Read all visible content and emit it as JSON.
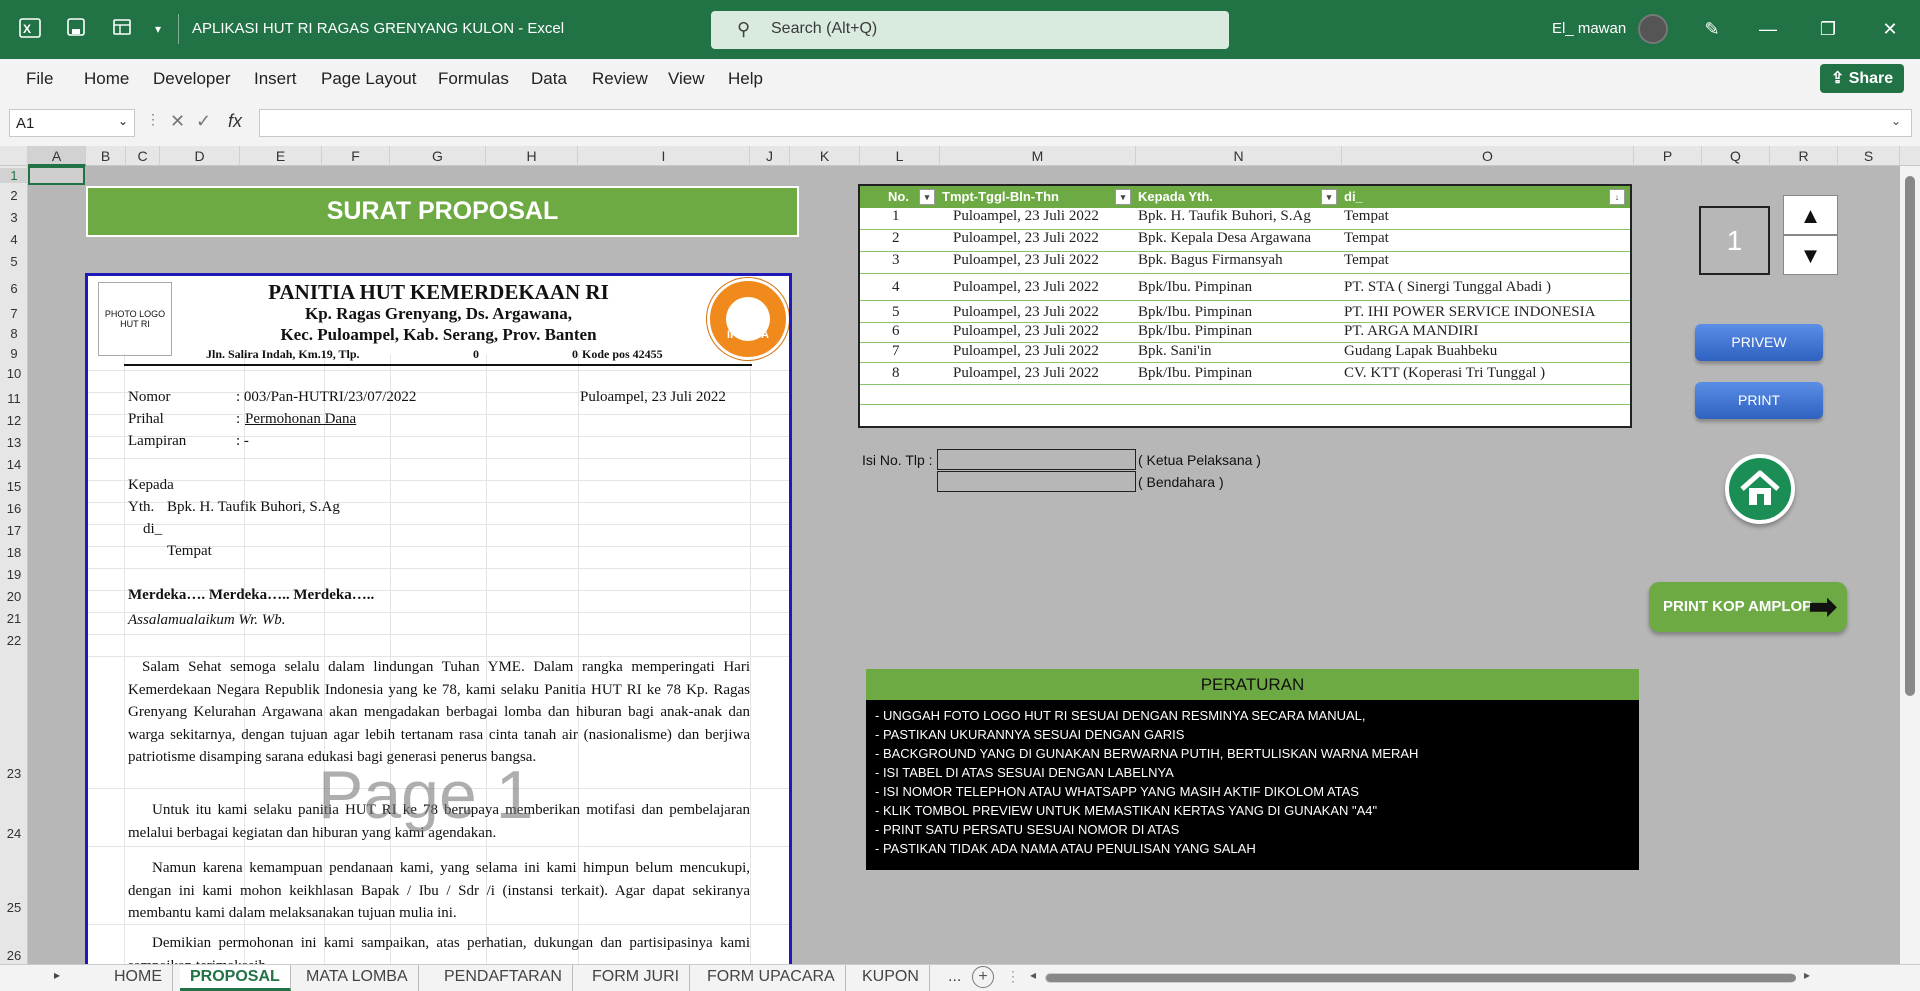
{
  "app": {
    "title": "APLIKASI HUT RI RAGAS GRENYANG KULON  -  Excel",
    "search_placeholder": "Search (Alt+Q)",
    "user": "El_ mawan",
    "share_label": "Share"
  },
  "ribbon": {
    "tabs": [
      "File",
      "Home",
      "Developer",
      "Insert",
      "Page Layout",
      "Formulas",
      "Data",
      "Review",
      "View",
      "Help"
    ]
  },
  "formula_bar": {
    "name_box": "A1",
    "formula": ""
  },
  "columns": [
    "A",
    "B",
    "C",
    "D",
    "E",
    "F",
    "G",
    "H",
    "I",
    "J",
    "K",
    "L",
    "M",
    "N",
    "O",
    "P",
    "Q",
    "R",
    "S"
  ],
  "rows": [
    "1",
    "2",
    "3",
    "4",
    "5",
    "6",
    "7",
    "8",
    "9",
    "10",
    "11",
    "12",
    "13",
    "14",
    "15",
    "16",
    "17",
    "18",
    "19",
    "20",
    "21",
    "22",
    "23",
    "24",
    "25",
    "26"
  ],
  "doc": {
    "banner": "SURAT PROPOSAL",
    "photo_label": "PHOTO LOGO HUT RI",
    "logo_text": "IPARGA",
    "kop1": "PANITIA HUT KEMERDEKAAN RI",
    "kop2": "Kp. Ragas Grenyang,  Ds. Argawana,",
    "kop3": "Kec. Puloampel, Kab. Serang, Prov. Banten",
    "kop4_addr": "Jln. Salira Indah, Km.19, Tlp.",
    "kop4_tlp1": "0",
    "kop4_tlp2": "0",
    "kop4_pos": "Kode pos 42455",
    "nomor_label": "Nomor",
    "nomor_value": ": 003/Pan-HUTRI/23/07/2022",
    "place_date": "Puloampel, 23 Juli 2022",
    "prihal_label": "Prihal",
    "prihal_value": "Permohonan Dana",
    "lampiran_label": "Lampiran",
    "lampiran_value": ": -",
    "kepada": "Kepada",
    "yth": "Yth.",
    "yth_name": "Bpk. H. Taufik Buhori, S.Ag",
    "di": "di_",
    "tempat": "Tempat",
    "merdeka": "Merdeka…. Merdeka….. Merdeka…..",
    "salam": "Assalamualaikum Wr. Wb.",
    "para1": "Salam Sehat semoga selalu dalam lindungan Tuhan YME. Dalam rangka memperingati Hari Kemerdekaan Negara Republik Indonesia yang ke 78, kami selaku Panitia HUT RI ke 78 Kp. Ragas Grenyang Kelurahan Argawana akan mengadakan berbagai lomba dan hiburan bagi anak-anak dan warga sekitarnya, dengan tujuan agar lebih tertanam rasa cinta tanah air (nasionalisme) dan berjiwa patriotisme disamping sarana edukasi bagi generasi penerus bangsa.",
    "para2": "Untuk itu kami selaku panitia HUT RI ke 78 berupaya memberikan motifasi dan pembelajaran melalui berbagai kegiatan dan hiburan yang kami agendakan.",
    "para3": "Namun karena kemampuan pendanaan kami, yang selama ini kami himpun belum mencukupi, dengan ini kami mohon keikhlasan Bapak / Ibu / Sdr /i (instansi terkait). Agar dapat sekiranya membantu kami dalam melaksanakan tujuan mulia ini.",
    "para4": "Demikian permohonan ini kami sampaikan, atas perhatian, dukungan dan partisipasinya kami sampaikan terimakasih.",
    "watermark": "Page 1"
  },
  "table": {
    "headers": [
      "No.",
      "Tmpt-Tggl-Bln-Thn",
      "Kepada Yth.",
      "di_"
    ],
    "rows": [
      [
        "1",
        "Puloampel, 23 Juli 2022",
        "Bpk. H. Taufik Buhori, S.Ag",
        "Tempat"
      ],
      [
        "2",
        "Puloampel, 23 Juli 2022",
        "Bpk. Kepala Desa Argawana",
        "Tempat"
      ],
      [
        "3",
        "Puloampel, 23 Juli 2022",
        "Bpk. Bagus Firmansyah",
        "Tempat"
      ],
      [
        "4",
        "Puloampel, 23 Juli 2022",
        "Bpk/Ibu. Pimpinan",
        "PT. STA ( Sinergi Tunggal Abadi )"
      ],
      [
        "5",
        "Puloampel, 23 Juli 2022",
        "Bpk/Ibu. Pimpinan",
        "PT. IHI POWER SERVICE INDONESIA"
      ],
      [
        "6",
        "Puloampel, 23 Juli 2022",
        "Bpk/Ibu. Pimpinan",
        "PT. ARGA MANDIRI"
      ],
      [
        "7",
        "Puloampel, 23 Juli 2022",
        "Bpk. Sani'in",
        "Gudang Lapak Buahbeku"
      ],
      [
        "8",
        "Puloampel, 23 Juli 2022",
        "Bpk/Ibu. Pimpinan",
        "CV. KTT (Koperasi Tri Tunggal )"
      ]
    ]
  },
  "tlp": {
    "label": "Isi No. Tlp :",
    "ketua": "( Ketua Pelaksana )",
    "bendahara": "( Bendahara )"
  },
  "controls": {
    "counter": "1",
    "preview": "PRIVEW",
    "print": "PRINT",
    "kop": "PRINT KOP AMPLOP"
  },
  "rules": {
    "title": "PERATURAN",
    "items": [
      "- UNGGAH FOTO LOGO HUT RI SESUAI DENGAN RESMINYA SECARA MANUAL,",
      "- PASTIKAN UKURANNYA SESUAI DENGAN GARIS",
      "- BACKGROUND YANG DI GUNAKAN BERWARNA PUTIH, BERTULISKAN WARNA MERAH",
      "- ISI TABEL DI ATAS SESUAI DENGAN LABELNYA",
      "- ISI NOMOR TELEPHON ATAU WHATSAPP YANG MASIH AKTIF DIKOLOM ATAS",
      "- KLIK TOMBOL PREVIEW UNTUK MEMASTIKAN KERTAS YANG DI GUNAKAN \"A4\"",
      "- PRINT SATU PERSATU SESUAI NOMOR DI ATAS",
      "- PASTIKAN TIDAK ADA NAMA ATAU PENULISAN YANG SALAH"
    ]
  },
  "sheets": [
    "HOME",
    "PROPOSAL",
    "MATA LOMBA",
    "PENDAFTARAN",
    "FORM JURI",
    "FORM UPACARA",
    "KUPON",
    "..."
  ],
  "active_sheet": "PROPOSAL",
  "colors": {
    "excel_green": "#217346",
    "accent_green": "#6eaa44",
    "button_blue": "#2f61c0"
  }
}
